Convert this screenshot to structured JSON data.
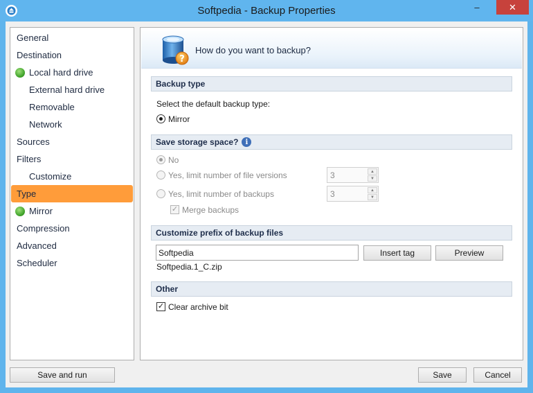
{
  "window": {
    "title": "Softpedia - Backup Properties",
    "controls": {
      "minimize": "–",
      "maximize": "☐",
      "close": "✕"
    }
  },
  "nav": {
    "items": [
      {
        "label": "General",
        "indent": false,
        "status": false,
        "selected": false
      },
      {
        "label": "Destination",
        "indent": false,
        "status": false,
        "selected": false
      },
      {
        "label": "Local hard drive",
        "indent": true,
        "status": true,
        "selected": false
      },
      {
        "label": "External hard drive",
        "indent": true,
        "status": false,
        "selected": false
      },
      {
        "label": "Removable",
        "indent": true,
        "status": false,
        "selected": false
      },
      {
        "label": "Network",
        "indent": true,
        "status": false,
        "selected": false
      },
      {
        "label": "Sources",
        "indent": false,
        "status": false,
        "selected": false
      },
      {
        "label": "Filters",
        "indent": false,
        "status": false,
        "selected": false
      },
      {
        "label": "Customize",
        "indent": true,
        "status": false,
        "selected": false
      },
      {
        "label": "Type",
        "indent": false,
        "status": false,
        "selected": true
      },
      {
        "label": "Mirror",
        "indent": true,
        "status": true,
        "selected": false
      },
      {
        "label": "Compression",
        "indent": false,
        "status": false,
        "selected": false
      },
      {
        "label": "Advanced",
        "indent": false,
        "status": false,
        "selected": false
      },
      {
        "label": "Scheduler",
        "indent": false,
        "status": false,
        "selected": false
      }
    ],
    "selected_color": "#ff9c3a"
  },
  "banner": {
    "question": "How do you want to backup?"
  },
  "backup_type": {
    "heading": "Backup type",
    "prompt": "Select the default backup type:",
    "option_mirror": "Mirror"
  },
  "storage": {
    "heading": "Save storage space?",
    "option_no": "No",
    "option_versions": "Yes, limit number of file versions",
    "versions_value": "3",
    "option_backups": "Yes, limit number of backups",
    "backups_value": "3",
    "merge_label": "Merge backups"
  },
  "prefix": {
    "heading": "Customize prefix of backup files",
    "value": "Softpedia",
    "insert_tag": "Insert tag",
    "preview": "Preview",
    "example": "Softpedia.1_C.zip"
  },
  "other": {
    "heading": "Other",
    "clear_archive": "Clear archive bit"
  },
  "footer": {
    "save_and_run": "Save and run",
    "save": "Save",
    "cancel": "Cancel"
  }
}
